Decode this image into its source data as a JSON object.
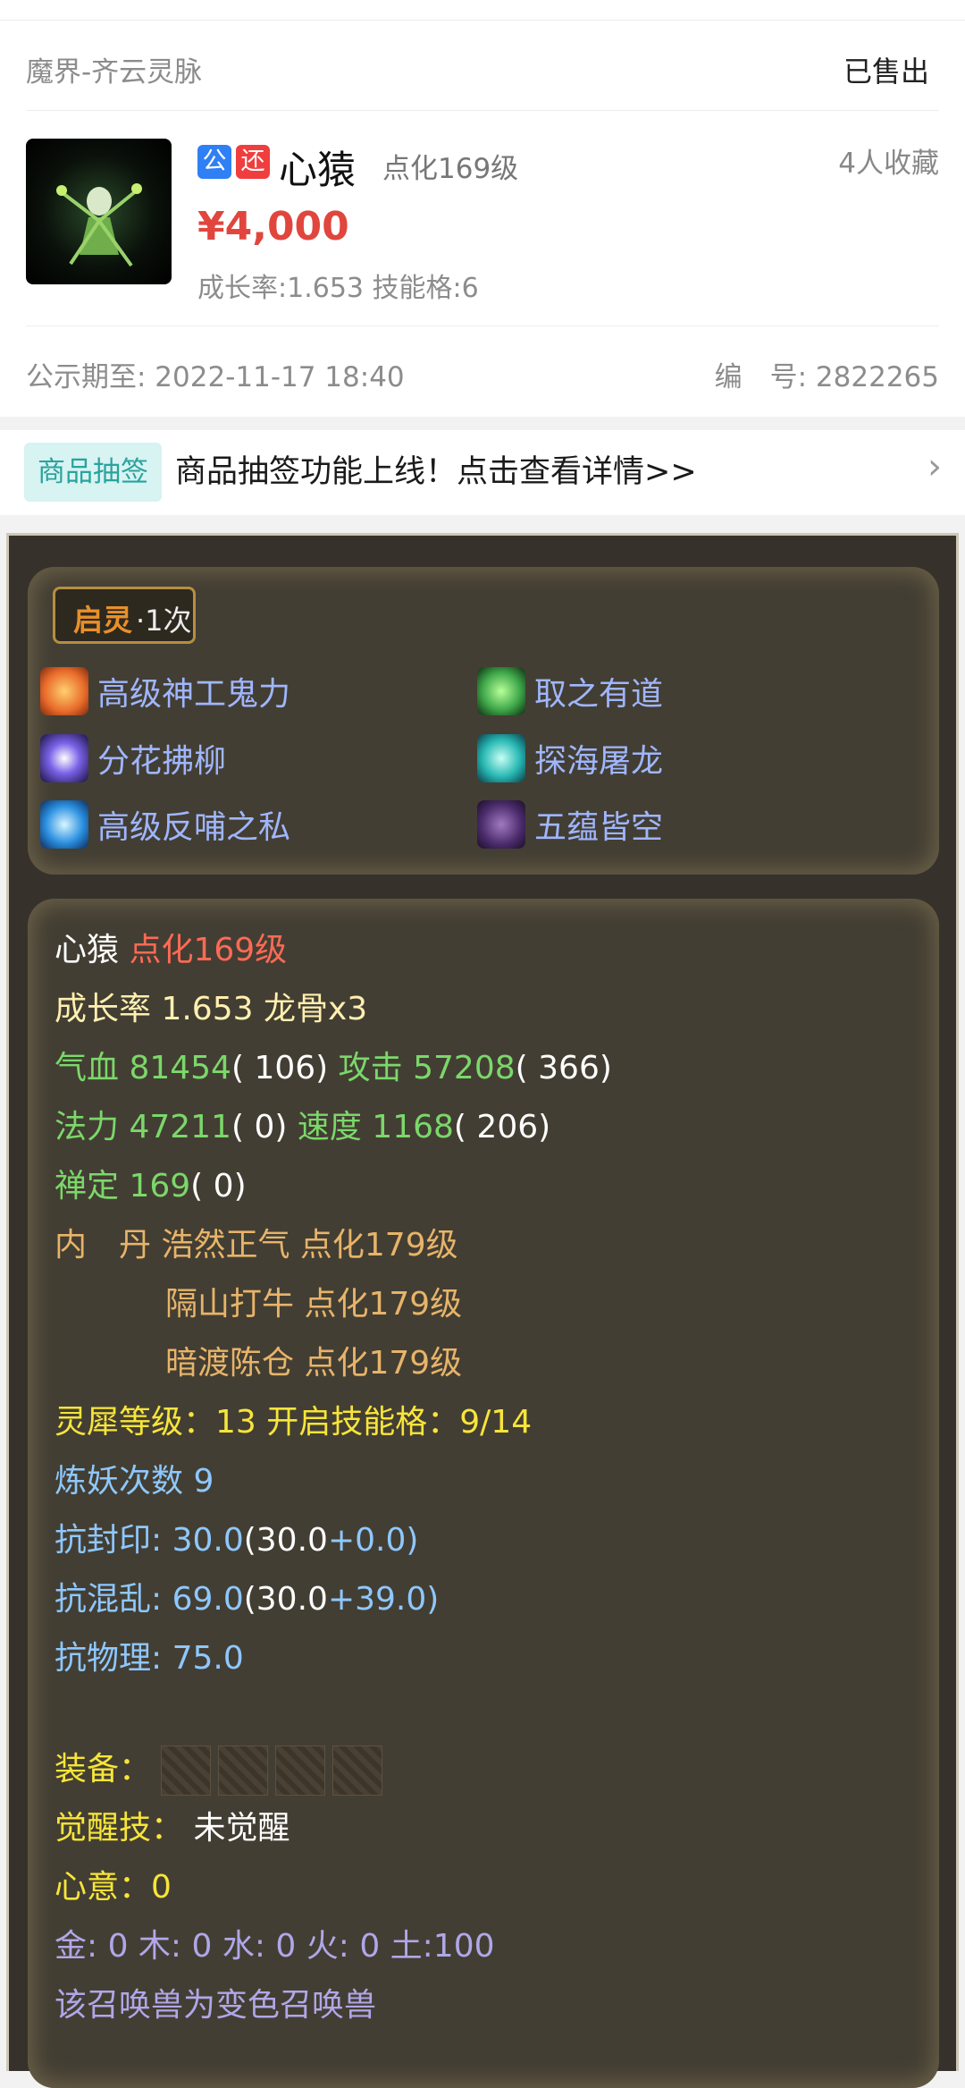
{
  "header": {
    "server": "魔界-齐云灵脉",
    "status": "已售出"
  },
  "product": {
    "badge_public": "公",
    "badge_return": "还",
    "name": "心猿",
    "level": "点化169级",
    "favorites": "4人收藏",
    "price": "¥4,000",
    "growth_skills": "成长率:1.653 技能格:6",
    "public_until": "公示期至: 2022-11-17 18:40",
    "serial": "编　号: 2822265"
  },
  "promo": {
    "tag": "商品抽签",
    "text": "商品抽签功能上线！点击查看详情>>",
    "chevron": "›"
  },
  "qiling": {
    "label": "启灵",
    "count": "·1次"
  },
  "skills": [
    {
      "name": "高级神工鬼力",
      "icon": "fist-fire-icon",
      "color": "#e86a2a"
    },
    {
      "name": "取之有道",
      "icon": "green-vortex-icon",
      "color": "#3fa84a"
    },
    {
      "name": "分花拂柳",
      "icon": "purple-swirl-icon",
      "color": "#5a3fb8"
    },
    {
      "name": "探海屠龙",
      "icon": "cyan-dragon-icon",
      "color": "#27b7b3"
    },
    {
      "name": "高级反哺之私",
      "icon": "blue-spirit-icon",
      "color": "#2a8fe0"
    },
    {
      "name": "五蕴皆空",
      "icon": "dark-mist-icon",
      "color": "#6a4a8a"
    }
  ],
  "stats": {
    "name": "心猿",
    "level": "点化169级",
    "growth": "成长率 1.653 龙骨x3",
    "hp_label": "气血 81454",
    "hp_add": "( 106)",
    "atk_label": "攻击 57208",
    "atk_add": "( 366)",
    "mp_label": "法力 47211",
    "mp_add": "( 0)",
    "spd_label": "速度 1168",
    "spd_add": "( 206)",
    "zen_label": "禅定 169",
    "zen_add": "( 0)",
    "neidan_1": "内　丹 浩然正气 点化179级",
    "neidan_2": "隔山打牛 点化179级",
    "neidan_3": "暗渡陈仓 点化179级",
    "lingxi": "灵犀等级：13 开启技能格：9/14",
    "lianyao": "炼妖次数 9",
    "seal_label": "抗封印: 30.0",
    "seal_open": "(",
    "seal_base": "30.0",
    "seal_plus": "+0.0)",
    "chaos_label": "抗混乱: 69.0",
    "chaos_open": "(",
    "chaos_base": "30.0",
    "chaos_plus": "+39.0)",
    "phys": "抗物理: 75.0",
    "equip_label": "装备：",
    "awaken_label": "觉醒技：",
    "awaken_value": "未觉醒",
    "xinyi": "心意：0",
    "elements": "金: 0 木: 0 水: 0 火: 0 土:100",
    "variant": "该召唤兽为变色召唤兽"
  }
}
